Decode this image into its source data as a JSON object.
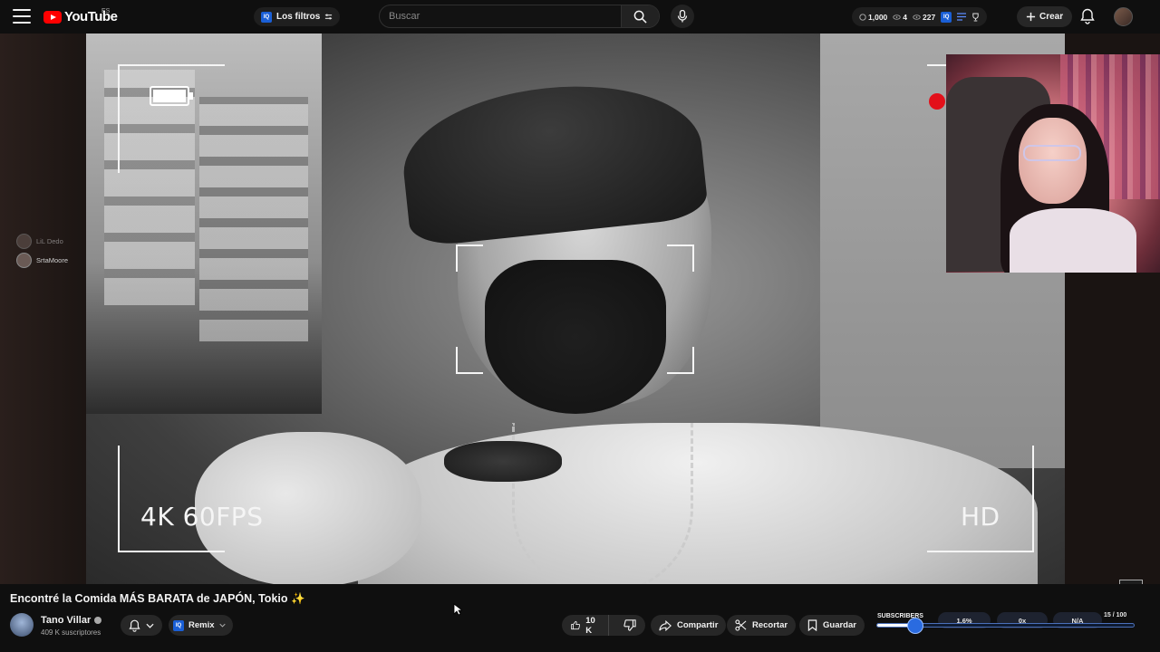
{
  "header": {
    "logo_text": "YouTube",
    "country_code": "ES",
    "filters_label": "Los filtros",
    "search_placeholder": "Buscar",
    "stats": {
      "views": "1,000",
      "watchers": "4",
      "count": "227"
    },
    "create_label": "Crear"
  },
  "video": {
    "overlay_left": "4K 60FPS",
    "overlay_right": "HD",
    "watermark_text": "V"
  },
  "chat_viewers": [
    {
      "name": "LiL Dedo"
    },
    {
      "name": "SrtaMoore"
    }
  ],
  "details": {
    "title": "Encontré la Comida MÁS BARATA de JAPÓN, Tokio",
    "title_emoji": "✨",
    "channel_name": "Tano Villar",
    "subscribers": "409 K suscriptores",
    "remix_label": "Remix",
    "likes": "10 K",
    "share_label": "Compartir",
    "clip_label": "Recortar",
    "save_label": "Guardar"
  },
  "subscriber_tracker": {
    "label": "SUBSCRIBERS",
    "percent": "1.6%",
    "multiplier": "0x",
    "eta": "N/A",
    "current": "15",
    "goal": "100",
    "progress": 0.15
  },
  "colors": {
    "accent_red": "#ff0000",
    "rec_red": "#e3101a",
    "ext_blue": "#1a5fd6"
  }
}
